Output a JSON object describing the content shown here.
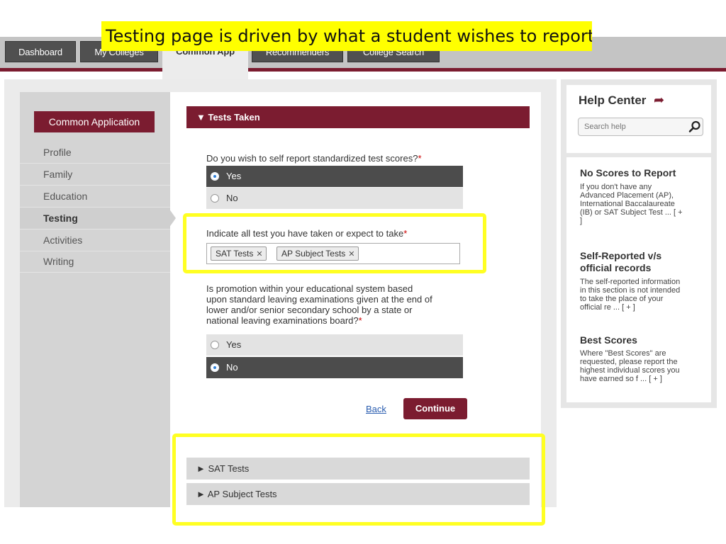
{
  "caption": "Testing page is driven by what a student wishes to report.",
  "nav": {
    "tabs": [
      {
        "label": "Dashboard"
      },
      {
        "label": "My Colleges"
      },
      {
        "label": "Common App"
      },
      {
        "label": "Recommenders"
      },
      {
        "label": "College Search"
      }
    ],
    "active_tab": "Common App"
  },
  "sidebar": {
    "app_button": "Common Application",
    "items": [
      {
        "label": "Profile"
      },
      {
        "label": "Family"
      },
      {
        "label": "Education"
      },
      {
        "label": "Testing"
      },
      {
        "label": "Activities"
      },
      {
        "label": "Writing"
      }
    ],
    "active_item": "Testing"
  },
  "tests_taken": {
    "header": "▼ Tests Taken",
    "q1": {
      "text": "Do you wish to self report standardized test scores?",
      "required": "*",
      "options": [
        "Yes",
        "No"
      ],
      "selected": "Yes"
    },
    "q2": {
      "text": "Indicate all test you have taken or expect to take",
      "required": "*",
      "tags": [
        {
          "label": "SAT Tests"
        },
        {
          "label": "AP Subject Tests"
        }
      ],
      "remove_glyph": "✕"
    },
    "q3": {
      "line1": "Is promotion within your educational system based",
      "line2": "upon standard leaving examinations given at the end of",
      "line3": "lower and/or senior secondary school by a state or",
      "line4": "national leaving examinations board?",
      "required": "*",
      "options": [
        "Yes",
        "No"
      ],
      "selected": "No"
    },
    "back_label": "Back",
    "continue_label": "Continue"
  },
  "accordions": [
    {
      "label": "► SAT Tests"
    },
    {
      "label": "► AP Subject Tests"
    }
  ],
  "help_center": {
    "title": "Help Center",
    "arrow_glyph": "➦",
    "search_placeholder": "Search help",
    "articles": [
      {
        "heading": "No Scores to Report",
        "lines": [
          "If you don't have any",
          "Advanced Placement (AP),",
          "International Baccalaureate",
          "(IB) or SAT Subject Test ... [ +",
          "]"
        ]
      },
      {
        "heading_line1": "Self-Reported v/s",
        "heading_line2": "official records",
        "lines": [
          "The self-reported information",
          "in this section is not intended",
          "to take the place of your",
          "official re ... [ + ]"
        ]
      },
      {
        "heading": "Best Scores",
        "lines": [
          "Where \"Best Scores\" are",
          "requested, please report the",
          "highest individual scores you",
          "have earned so f ... [ + ]"
        ]
      }
    ]
  },
  "colors": {
    "brand": "#7b1c30",
    "highlight": "#ffff22",
    "caption_bg": "#ffff00",
    "selected_option": "#4c4c4c"
  }
}
